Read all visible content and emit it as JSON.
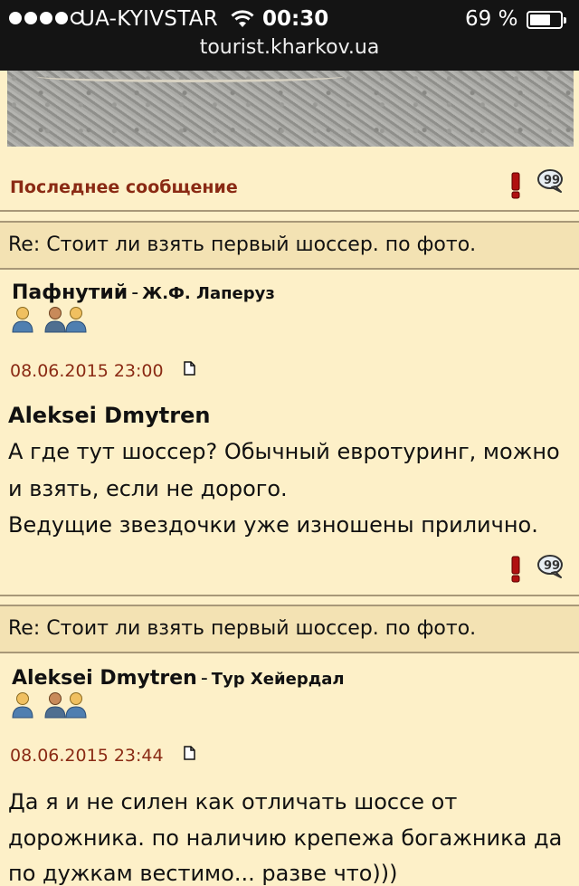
{
  "status_bar": {
    "carrier": "UA-KYIVSTAR",
    "time": "00:30",
    "battery_percent": "69 %",
    "battery_level": 0.69,
    "url": "tourist.kharkov.ua"
  },
  "top_section": {
    "last_message_link": "Последнее сообщение"
  },
  "posts": [
    {
      "thread_title": "Re: Стоит ли взять первый шоссер. по фото.",
      "author": "Пафнутий",
      "separator": "-",
      "rank": "Ж.Ф. Лаперуз",
      "date": "08.06.2015 23:00",
      "quote_author": "Aleksei Dmytren",
      "lines": [
        "А где тут шоссер? Обычный евротуринг, можно",
        "и взять, если не дорого.",
        "Ведущие звездочки уже изношены прилично."
      ]
    },
    {
      "thread_title": "Re: Стоит ли взять первый шоссер. по фото.",
      "author": "Aleksei Dmytren",
      "separator": "-",
      "rank": "Тур Хейердал",
      "date": "08.06.2015 23:44",
      "lines": [
        "Да я и не силен как отличать шоссе от",
        "дорожника. по наличию крепежа богажника да",
        "по дужкам вестимо... разве что)))"
      ]
    }
  ],
  "colors": {
    "background": "#fdf0c8",
    "accent_red": "#8a2a14",
    "thread_bar": "#f3e2b3"
  }
}
